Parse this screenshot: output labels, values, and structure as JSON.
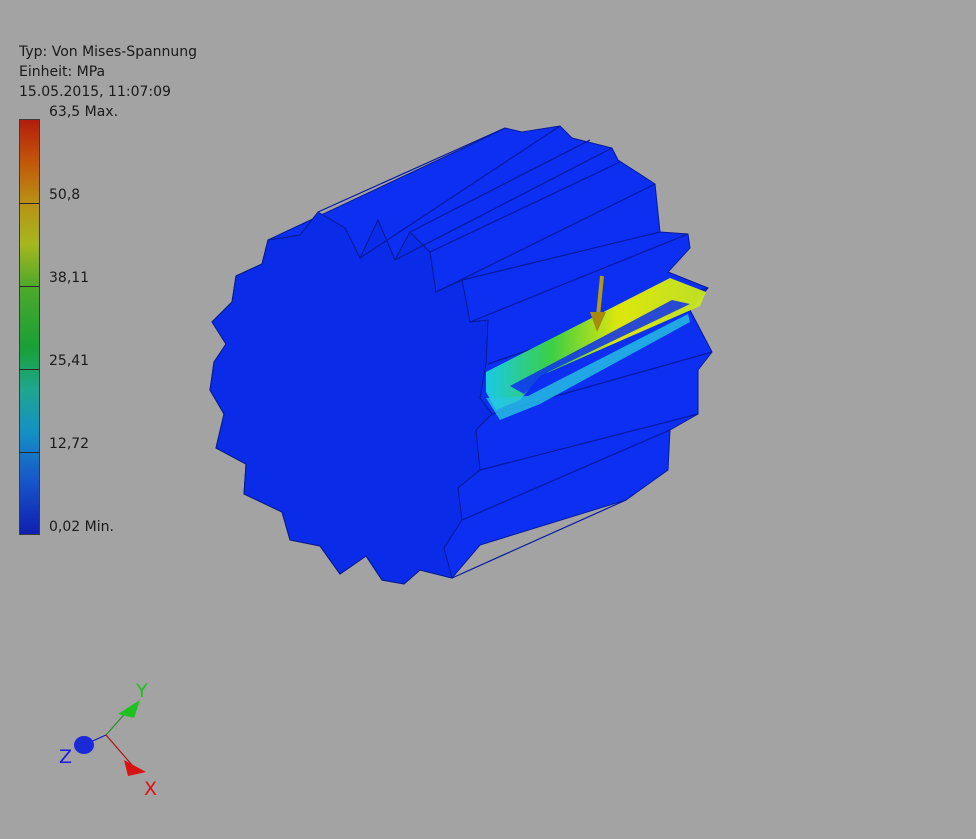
{
  "legend": {
    "type_label": "Typ: Von Mises-Spannung",
    "unit_label": "Einheit: MPa",
    "timestamp": "15.05.2015, 11:07:09",
    "scale_labels": [
      "63,5 Max.",
      "50,8",
      "38,11",
      "25,41",
      "12,72",
      "0,02 Min."
    ],
    "colors": [
      "#b11d0c",
      "#c3560a",
      "#b99114",
      "#4fa92a",
      "#1492c3",
      "#0f1fb0"
    ]
  },
  "axes": {
    "x_label": "X",
    "y_label": "Y",
    "z_label": "Z",
    "x_color": "#e01010",
    "y_color": "#1ec21e",
    "z_color": "#1a1ae0"
  },
  "model": {
    "name": "spur-gear",
    "body_color": "#0c2ff2",
    "hotspot_colors": [
      "#e8f000",
      "#3fd83a",
      "#1ad1e6"
    ],
    "load_arrow_color": "#b49a12"
  }
}
